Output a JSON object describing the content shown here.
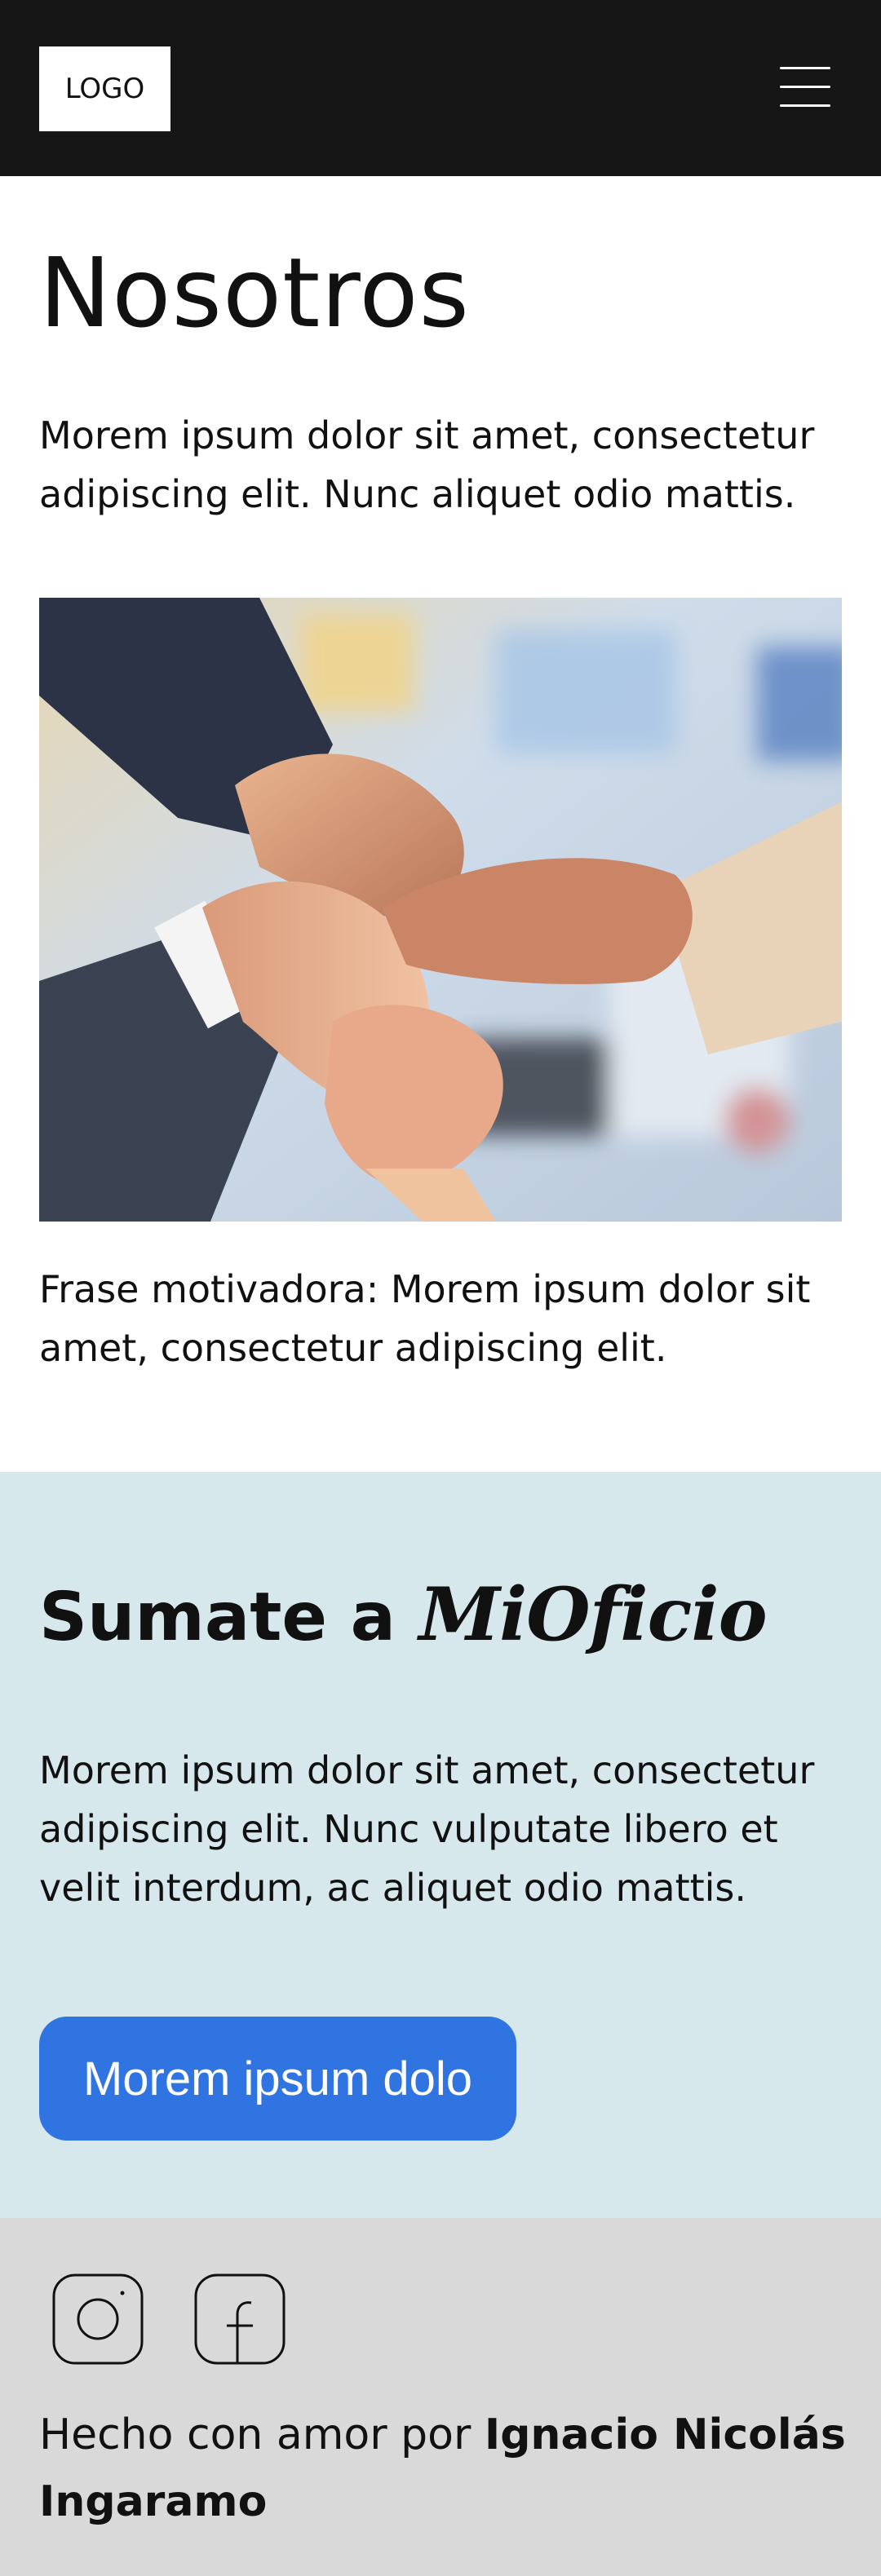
{
  "header": {
    "logo_text": "LOGO",
    "menu_icon": "hamburger-menu-icon",
    "background": "#161616"
  },
  "about": {
    "title": "Nosotros",
    "intro": "Morem ipsum dolor sit amet, consectetur adipiscing elit. Nunc aliquet odio mattis.",
    "image_subject": "team-hands-joined-photo",
    "quote": "Frase motivadora: Morem ipsum dolor sit amet, consectetur adipiscing elit."
  },
  "join": {
    "title_prefix": "Sumate a",
    "brand_name": "MiOficio",
    "text": "Morem ipsum dolor sit amet, consectetur adipiscing elit. Nunc vulputate libero et velit interdum, ac aliquet odio mattis.",
    "button_label": "Morem ipsum dolo",
    "background": "#d7e8ed",
    "button_color": "#2f74e0"
  },
  "footer": {
    "social_icons": [
      "instagram-icon",
      "facebook-icon"
    ],
    "credit_prefix": "Hecho con amor por",
    "credit_author": "Ignacio Nicolás Ingaramo",
    "background": "#d9d9d9"
  }
}
